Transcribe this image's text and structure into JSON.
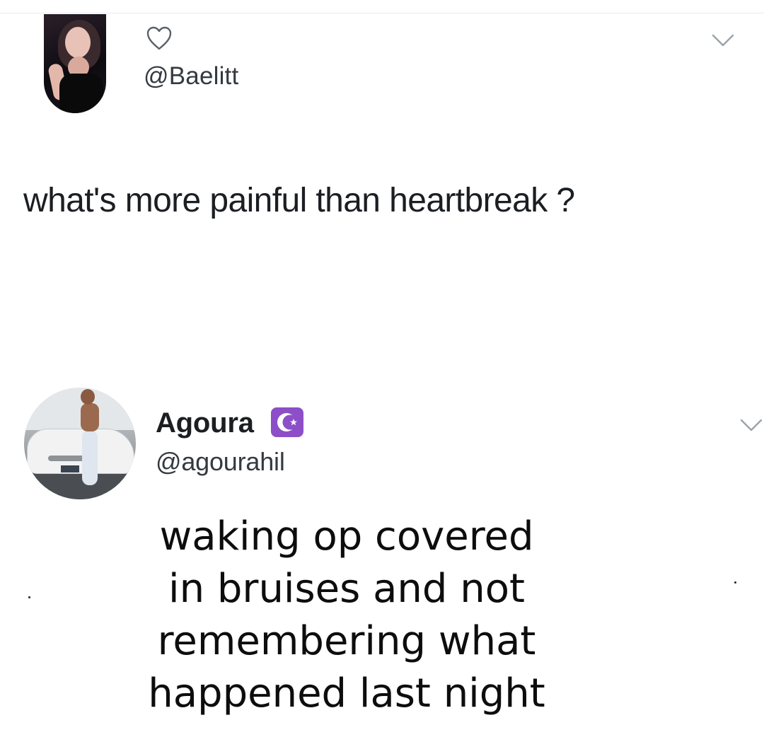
{
  "tweet_1": {
    "handle": "@Baelitt",
    "text": "what's more painful than heartbreak ?",
    "icons": [
      "heart-icon",
      "chevron-down-icon"
    ]
  },
  "tweet_2": {
    "display_name": "Agoura",
    "badge_icon": "crescent-star-icon",
    "badge_color": "#8c4fc7",
    "handle": "@agourahil",
    "icons": [
      "chevron-down-icon"
    ]
  },
  "caption": {
    "lines": [
      "waking op covered",
      "in bruises and not",
      "remembering what",
      "happened last night"
    ]
  }
}
